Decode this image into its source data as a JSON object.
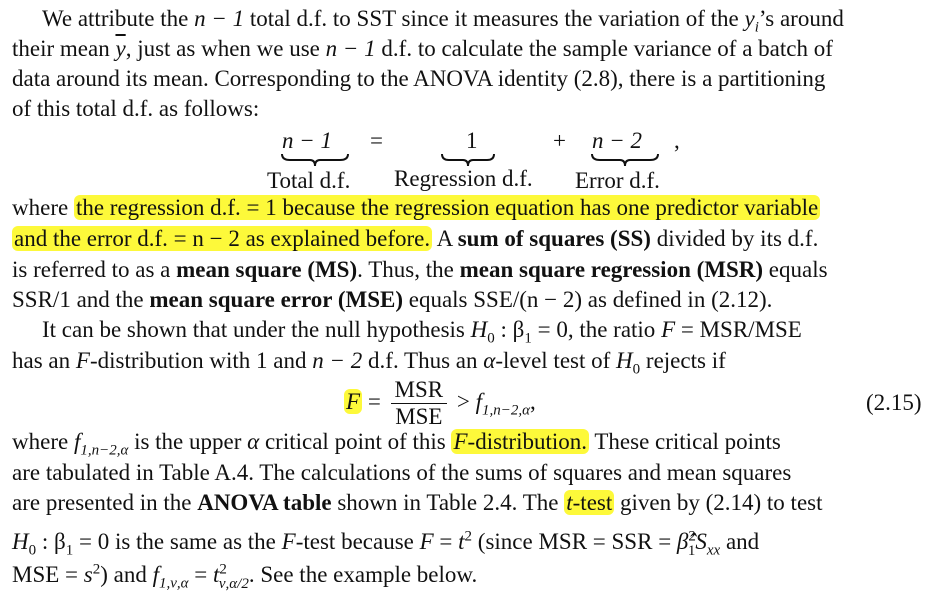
{
  "lines": {
    "l1_a": "We attribute the ",
    "l1_m": "n − 1",
    "l1_b": " total d.f. to SST since it measures the variation of the ",
    "l1_y": "y",
    "l1_yi": "i",
    "l1_c": "’s around",
    "l2_a": "their mean ",
    "l2_ybar": "y",
    "l2_b": ", just as when we use ",
    "l2_m": "n − 1",
    "l2_c": " d.f. to calculate the sample variance of a batch of",
    "l3": "data around its mean. Corresponding to the ANOVA identity (2.8), there is a partitioning",
    "l4": "of this total d.f. as follows:",
    "eq1_lhs": "n − 1",
    "eq1_eq": "=",
    "eq1_one": "1",
    "eq1_plus": "+",
    "eq1_rhs": "n − 2",
    "eq1_comma": ",",
    "lbl_total": "Total d.f.",
    "lbl_reg": "Regression d.f.",
    "lbl_err": "Error d.f.",
    "l5_a": "where ",
    "l5_hl": "the regression d.f. = 1 because the regression equation has one predictor variable",
    "l6_hl": "and the error d.f. = n − 2 as explained before.",
    "l6_b": " A ",
    "l6_bold": "sum of squares (SS)",
    "l6_c": " divided by its d.f.",
    "l7_a": "is referred to as a ",
    "l7_bold1": "mean square (MS)",
    "l7_b": ". Thus, the ",
    "l7_bold2": "mean square regression (MSR)",
    "l7_c": " equals",
    "l8_a": "SSR/1 and the ",
    "l8_bold": "mean square error (MSE)",
    "l8_b": " equals SSE/(n − 2) as defined in (2.12).",
    "l9_a": "It can be shown that under the null hypothesis ",
    "l9_m1": "H",
    "l9_m1s": "0",
    "l9_m2": " : β",
    "l9_m2s": "1",
    "l9_m3": " = 0, the ratio ",
    "l9_F": "F",
    "l9_b": " = MSR/MSE",
    "l10_a": "has an ",
    "l10_F": "F",
    "l10_b": "-distribution with 1 and ",
    "l10_m": "n − 2",
    "l10_c": " d.f. Thus an ",
    "l10_alpha": "α",
    "l10_d": "-level test of ",
    "l10_H": "H",
    "l10_Hs": "0",
    "l10_e": " rejects if",
    "eq2_F": "F",
    "eq2_eq": "=",
    "eq2_num": "MSR",
    "eq2_den": "MSE",
    "eq2_gt": "> ",
    "eq2_f": "f",
    "eq2_fs": "1,n−2,α",
    "eq2_comma": ",",
    "eq2_tag": "(2.15)",
    "l11_a": "where ",
    "l11_f": "f",
    "l11_fs": "1,n−2,α",
    "l11_b": " is the upper ",
    "l11_alpha": "α",
    "l11_c": " critical point of this ",
    "l11_hl_F": "F",
    "l11_hl": "-distribution.",
    "l11_d": " These critical points",
    "l12": "are tabulated in Table A.4. The calculations of the sums of squares and mean squares",
    "l13_a": "are presented in the ",
    "l13_bold": "ANOVA table",
    "l13_b": " shown in Table 2.4. The ",
    "l13_hl_t": "t",
    "l13_hl": "-test",
    "l13_c": " given by (2.14) to test",
    "l14_H": "H",
    "l14_Hs": "0",
    "l14_a": " : β",
    "l14_as": "1",
    "l14_b": " = 0 is the same as the ",
    "l14_F": "F",
    "l14_c": "-test because ",
    "l14_F2": "F",
    "l14_d": " = ",
    "l14_t": "t",
    "l14_t2": "2",
    "l14_e": " (since MSR = SSR = ",
    "l14_beta": "β̂",
    "l14_betas": "1",
    "l14_beta2": "2",
    "l14_S": "S",
    "l14_Ss": "xx",
    "l14_f": " and",
    "l15_a": "MSE = ",
    "l15_s": "s",
    "l15_s2": "2",
    "l15_b": ") and ",
    "l15_f": "f",
    "l15_fs": "1,ν,α",
    "l15_c": " = ",
    "l15_t": "t",
    "l15_ts": "ν,α/2",
    "l15_t2": "2",
    "l15_d": ". See the example below."
  }
}
